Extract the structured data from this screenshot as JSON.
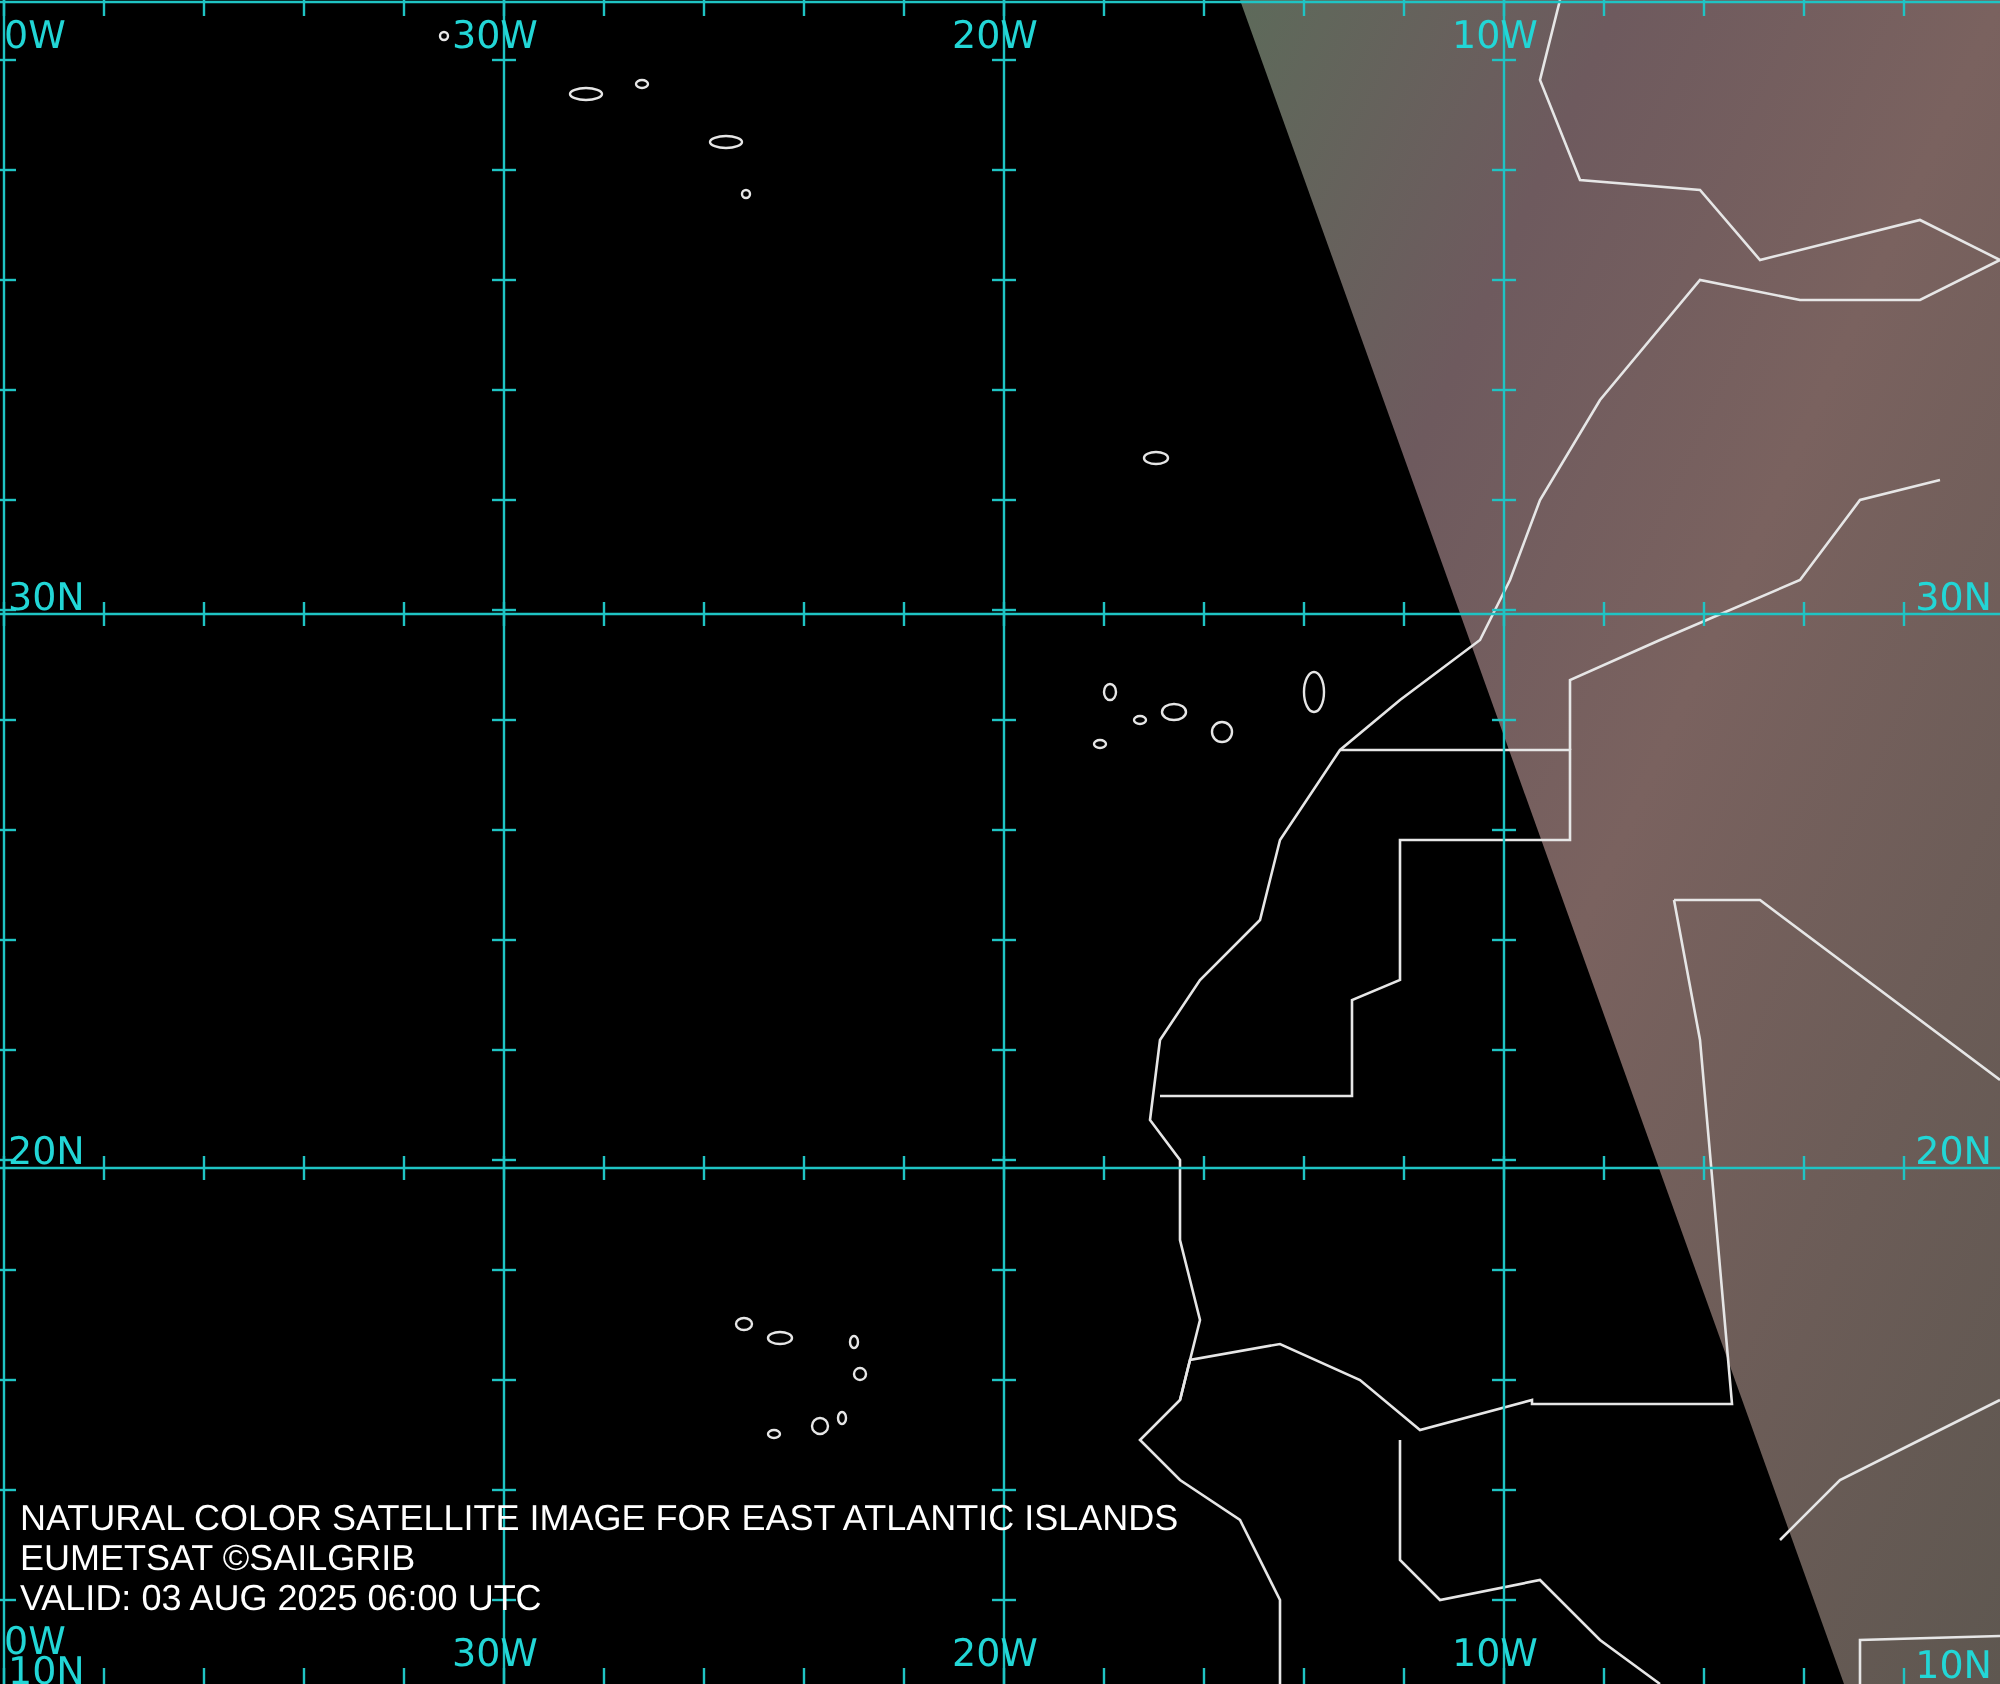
{
  "map": {
    "top_labels": [
      "0W",
      "30W",
      "20W",
      "10W"
    ],
    "bottom_labels": [
      "0W",
      "30W",
      "20W",
      "10W"
    ],
    "left_labels": [
      "30N",
      "20N",
      "10N"
    ],
    "right_labels": [
      "30N",
      "20N",
      "10N"
    ]
  },
  "caption": [
    "NATURAL COLOR SATELLITE IMAGE FOR EAST ATLANTIC ISLANDS",
    "EUMETSAT ©SAILGRIB",
    "VALID:  03 AUG 2025 06:00 UTC"
  ]
}
